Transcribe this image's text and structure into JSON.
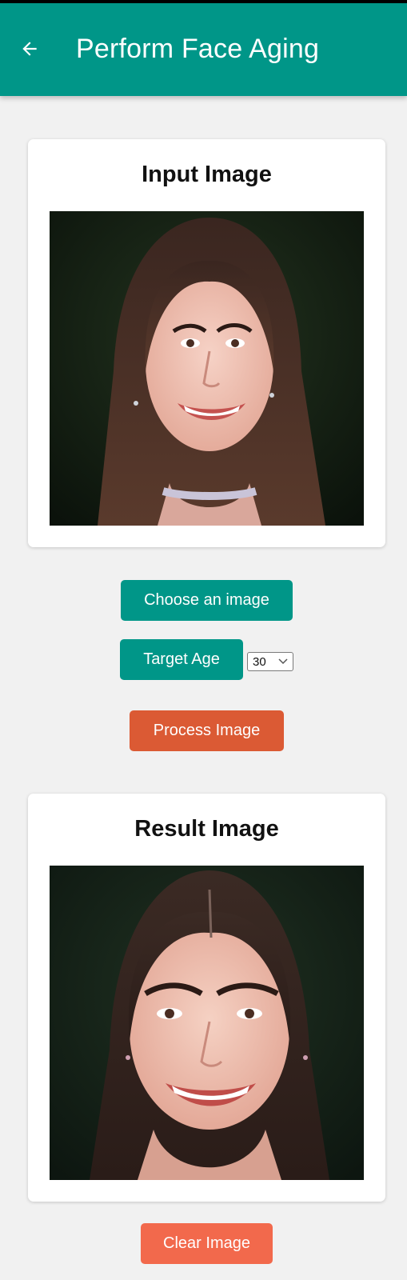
{
  "app_bar": {
    "title": "Perform Face Aging",
    "back_icon": "arrow-left-icon",
    "color": "#009688"
  },
  "input_card": {
    "title": "Input Image"
  },
  "controls": {
    "choose_label": "Choose an image",
    "target_age_label": "Target Age",
    "target_age_value": "30",
    "process_label": "Process Image"
  },
  "result_card": {
    "title": "Result Image"
  },
  "footer": {
    "clear_label": "Clear Image"
  },
  "colors": {
    "primary": "#009688",
    "process": "#db5a34",
    "clear": "#f2694c",
    "background": "#f1f1f1"
  }
}
